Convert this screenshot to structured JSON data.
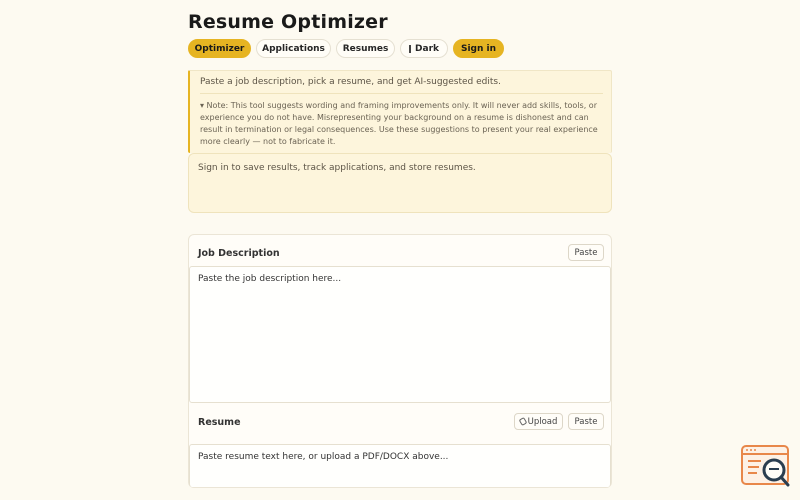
{
  "app": {
    "title": "Resume Optimizer"
  },
  "nav": {
    "items": [
      {
        "label": "Optimizer"
      },
      {
        "label": "Applications"
      },
      {
        "label": "Resumes"
      },
      {
        "label": "Dark"
      },
      {
        "label": "Sign in"
      }
    ]
  },
  "notice": {
    "lead": "Paste a job description, pick a resume, and get AI-suggested edits.",
    "detail": "▾ Note: This tool suggests wording and framing improvements only. It will never add skills, tools, or experience you do not have. Misrepresenting your background on a resume is dishonest and can result in termination or legal consequences. Use these suggestions to present your real experience more clearly — not to fabricate it."
  },
  "signin_notice": {
    "text": "Sign in to save results, track applications, and store resumes."
  },
  "job_description": {
    "title": "Job Description",
    "paste_label": "Paste",
    "placeholder": "Paste the job description here..."
  },
  "resume": {
    "title": "Resume",
    "upload_label": "Upload",
    "paste_label": "Paste",
    "placeholder": "Paste resume text here, or upload a PDF/DOCX above..."
  },
  "colors": {
    "accent": "#e6b422",
    "background": "#fdfaf1",
    "notice_bg": "#fdf5dc",
    "fab": "#e8874a"
  },
  "icons": [
    "moon-icon",
    "paperclip-icon",
    "search-chat-icon"
  ]
}
